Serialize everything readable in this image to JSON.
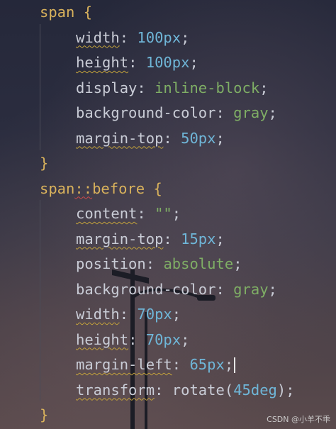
{
  "editor": {
    "rule1": {
      "selector": "span",
      "open": "{",
      "close": "}",
      "declarations": [
        {
          "prop": "width",
          "value": "100px",
          "vtype": "num",
          "squiggle": true
        },
        {
          "prop": "height",
          "value": "100px",
          "vtype": "num",
          "squiggle": true
        },
        {
          "prop": "display",
          "value": "inline-block",
          "vtype": "kw",
          "squiggle": false
        },
        {
          "prop": "background-color",
          "value": "gray",
          "vtype": "kw",
          "squiggle": false
        },
        {
          "prop": "margin-top",
          "value": "50px",
          "vtype": "num",
          "squiggle": true
        }
      ]
    },
    "rule2": {
      "selector_a": "span",
      "selector_sep": "::",
      "selector_b": "before",
      "open": "{",
      "close": "}",
      "declarations": [
        {
          "prop": "content",
          "value": "\"\"",
          "vtype": "str",
          "squiggle": true
        },
        {
          "prop": "margin-top",
          "value": "15px",
          "vtype": "num",
          "squiggle": true
        },
        {
          "prop": "position",
          "value": "absolute",
          "vtype": "kw",
          "squiggle": false
        },
        {
          "prop": "background-color",
          "value": "gray",
          "vtype": "kw",
          "squiggle": false
        },
        {
          "prop": "width",
          "value": "70px",
          "vtype": "num",
          "squiggle": true
        },
        {
          "prop": "height",
          "value": "70px",
          "vtype": "num",
          "squiggle": true
        },
        {
          "prop": "margin-left",
          "value": "65px",
          "vtype": "num",
          "squiggle": true,
          "caret": true
        },
        {
          "prop": "transform",
          "value": "rotate(45deg)",
          "vtype": "mixed",
          "fn": "rotate",
          "arg": "45deg",
          "squiggle": true
        }
      ]
    }
  },
  "colors": {
    "selector": "#d9b25c",
    "number": "#6fb6d8",
    "keyword": "#7fae65",
    "text": "#c9ccd6"
  },
  "watermark": "CSDN @小羊不乖"
}
